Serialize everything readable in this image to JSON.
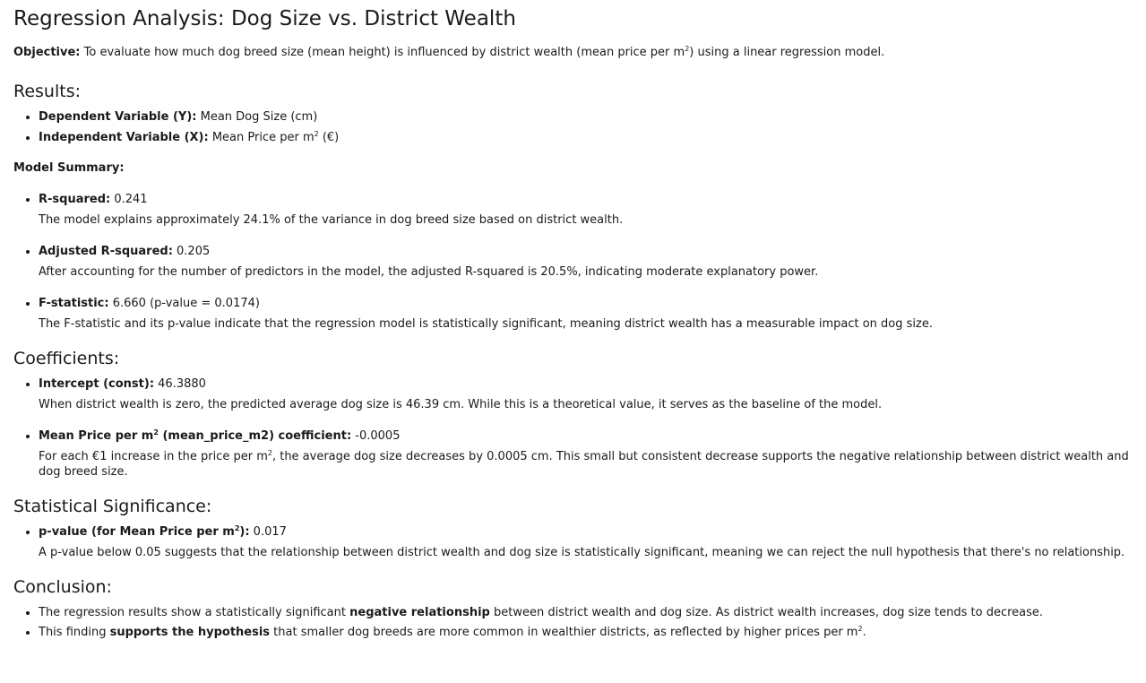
{
  "title": "Regression Analysis: Dog Size vs. District Wealth",
  "objective": {
    "label": "Objective:",
    "text_before": " To evaluate how much dog breed size (mean height) is influenced by district wealth (mean price per m",
    "sup": "2",
    "text_after": ") using a linear regression model."
  },
  "results": {
    "heading": "Results:",
    "dependent": {
      "label": "Dependent Variable (Y):",
      "value": " Mean Dog Size (cm)"
    },
    "independent": {
      "label": "Independent Variable (X):",
      "value_before": " Mean Price per m",
      "sup": "2",
      "value_after": " (€)"
    }
  },
  "model_summary": {
    "heading": "Model Summary:",
    "r_squared": {
      "label": "R-squared:",
      "value": " 0.241",
      "desc": "The model explains approximately 24.1% of the variance in dog breed size based on district wealth."
    },
    "adj_r_squared": {
      "label": "Adjusted R-squared:",
      "value": " 0.205",
      "desc": "After accounting for the number of predictors in the model, the adjusted R-squared is 20.5%, indicating moderate explanatory power."
    },
    "f_statistic": {
      "label": "F-statistic:",
      "value": " 6.660 (p-value = 0.0174)",
      "desc": "The F-statistic and its p-value indicate that the regression model is statistically significant, meaning district wealth has a measurable impact on dog size."
    }
  },
  "coefficients": {
    "heading": "Coefficients:",
    "intercept": {
      "label": "Intercept (const):",
      "value": " 46.3880",
      "desc": "When district wealth is zero, the predicted average dog size is 46.39 cm. While this is a theoretical value, it serves as the baseline of the model."
    },
    "mean_price": {
      "label_before": "Mean Price per m",
      "sup": "2",
      "label_after": " (mean_price_m2) coefficient:",
      "value": " -0.0005",
      "desc_before": "For each €1 increase in the price per m",
      "desc_sup": "2",
      "desc_after": ", the average dog size decreases by 0.0005 cm. This small but consistent decrease supports the negative relationship between district wealth and dog breed size."
    }
  },
  "significance": {
    "heading": "Statistical Significance:",
    "p_value": {
      "label_before": "p-value (for Mean Price per m",
      "sup": "2",
      "label_after": "):",
      "value": " 0.017",
      "desc": "A p-value below 0.05 suggests that the relationship between district wealth and dog size is statistically significant, meaning we can reject the null hypothesis that there's no relationship."
    }
  },
  "conclusion": {
    "heading": "Conclusion:",
    "item1": {
      "before": "The regression results show a statistically significant ",
      "bold": "negative relationship",
      "after": " between district wealth and dog size. As district wealth increases, dog size tends to decrease."
    },
    "item2": {
      "before": "This finding ",
      "bold": "supports the hypothesis",
      "after_before_sup": " that smaller dog breeds are more common in wealthier districts, as reflected by higher prices per m",
      "sup": "2",
      "end": "."
    }
  }
}
